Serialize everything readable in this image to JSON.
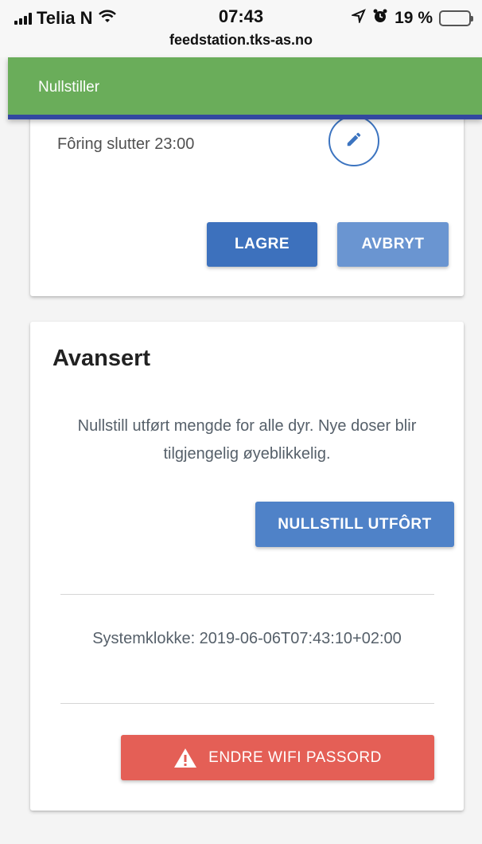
{
  "status_bar": {
    "carrier": "Telia N",
    "time": "07:43",
    "url": "feedstation.tks-as.no",
    "battery_percent": "19 %",
    "icons": [
      "signal-icon",
      "wifi-icon",
      "location-icon",
      "alarm-icon",
      "battery-icon"
    ]
  },
  "app_bar": {
    "title": "Nullstiller",
    "color": "#6aad5a",
    "accent_border": "#3248a0"
  },
  "feeding_card": {
    "feed_end_text": "Fôring slutter 23:00",
    "edit_icon": "pencil-icon",
    "save_label": "LAGRE",
    "cancel_label": "AVBRYT"
  },
  "advanced_card": {
    "title": "Avansert",
    "description": "Nullstill utført mengde for alle dyr. Nye doser blir tilgjengelig øyeblikkelig.",
    "reset_label": "NULLSTILL UTFÔRT",
    "system_clock": "Systemklokke: 2019-06-06T07:43:10+02:00",
    "wifi_label": "ENDRE WIFI PASSORD",
    "wifi_icon": "warning-icon"
  },
  "colors": {
    "primary": "#3d71bd",
    "primary_light": "#6a95d1",
    "danger": "#e45f56"
  }
}
